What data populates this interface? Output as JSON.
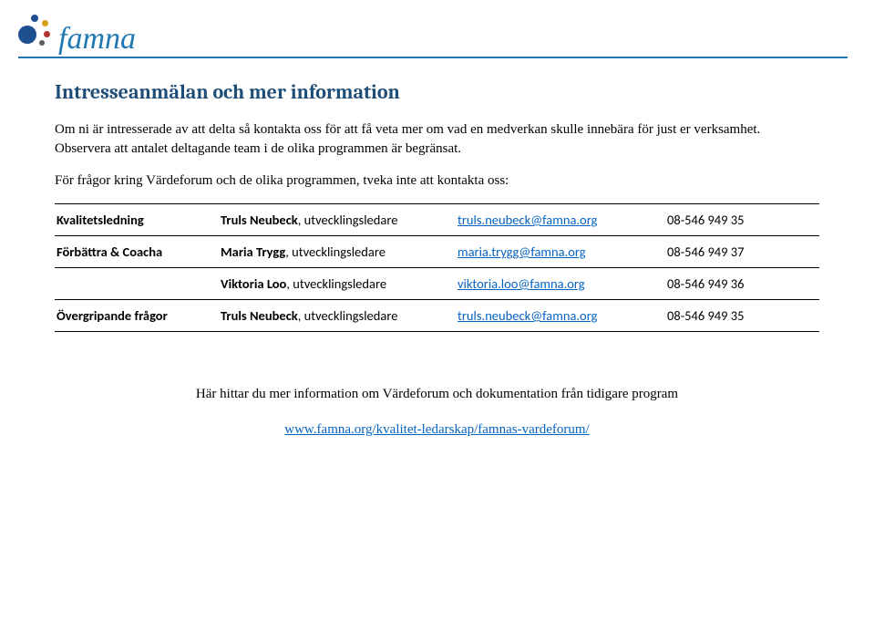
{
  "logo_text": "famna",
  "heading": "Intresseanmälan och mer information",
  "paragraph1": "Om ni är intresserade av att delta så kontakta oss för att få veta mer om vad en medverkan skulle innebära för just er verksamhet. Observera att antalet deltagande team i de olika programmen är begränsat.",
  "paragraph2": "För frågor kring Värdeforum och de olika programmen, tveka inte att kontakta oss:",
  "rows": [
    {
      "topic": "Kvalitetsledning",
      "name_bold": "Truls Neubeck",
      "role": ", utvecklingsledare",
      "email": "truls.neubeck@famna.org",
      "phone": "08-546 949 35"
    },
    {
      "topic": "Förbättra & Coacha",
      "name_bold": "Maria Trygg",
      "role": ", utvecklingsledare",
      "email": "maria.trygg@famna.org",
      "phone": "08-546 949 37"
    },
    {
      "topic": "",
      "name_bold": "Viktoria Loo",
      "role": ", utvecklingsledare",
      "email": "viktoria.loo@famna.org",
      "phone": "08-546 949 36"
    },
    {
      "topic": "Övergripande frågor",
      "name_bold": "Truls Neubeck",
      "role": ", utvecklingsledare",
      "email": "truls.neubeck@famna.org",
      "phone": "08-546 949 35"
    }
  ],
  "footer_text": "Här hittar du mer information om Värdeforum och dokumentation från tidigare program",
  "footer_link": "www.famna.org/kvalitet-ledarskap/famnas-vardeforum/"
}
